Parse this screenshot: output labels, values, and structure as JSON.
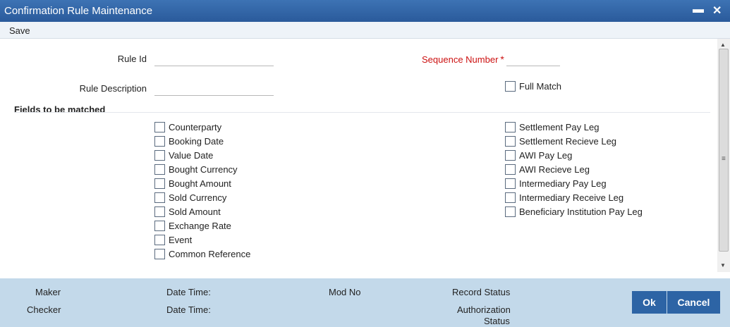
{
  "window": {
    "title": "Confirmation Rule Maintenance"
  },
  "menu": {
    "save": "Save"
  },
  "form": {
    "rule_id": {
      "label": "Rule Id",
      "value": ""
    },
    "sequence_number": {
      "label": "Sequence Number",
      "required_mark": "*",
      "value": ""
    },
    "rule_description": {
      "label": "Rule Description",
      "value": ""
    },
    "full_match": {
      "label": "Full Match",
      "checked": false
    }
  },
  "fields_section": {
    "title": "Fields to be matched",
    "left": [
      "Counterparty",
      "Booking Date",
      "Value Date",
      "Bought Currency",
      "Bought Amount",
      "Sold Currency",
      "Sold Amount",
      "Exchange Rate",
      "Event",
      "Common Reference"
    ],
    "right": [
      "Settlement Pay Leg",
      "Settlement Recieve Leg",
      "AWI Pay Leg",
      "AWI Recieve Leg",
      "Intermediary Pay Leg",
      "Intermediary Receive Leg",
      "Beneficiary Institution Pay Leg"
    ]
  },
  "footer": {
    "maker": "Maker",
    "checker": "Checker",
    "date_time_1": "Date Time:",
    "date_time_2": "Date Time:",
    "mod_no": "Mod No",
    "record_status": "Record Status",
    "authorization_status_line1": "Authorization",
    "authorization_status_line2": "Status",
    "ok": "Ok",
    "cancel": "Cancel"
  },
  "colors": {
    "titlebar": "#2d64a5",
    "footer": "#c3d9ea",
    "required": "#cc1111",
    "button": "#2d64a5"
  }
}
